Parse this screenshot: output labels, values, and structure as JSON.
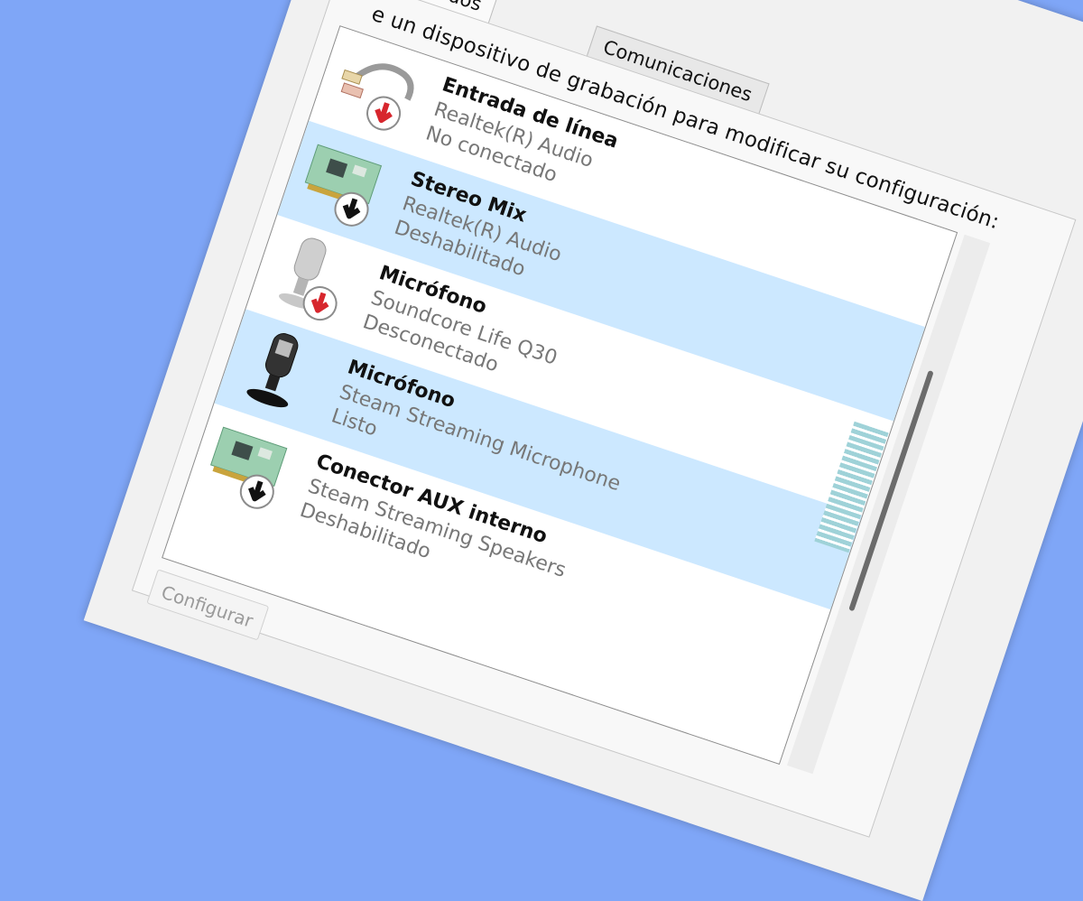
{
  "dialog": {
    "close_symbol": "×",
    "tabs": [
      {
        "label": "nidos"
      },
      {
        "label": "Comunicaciones"
      }
    ],
    "instruction": "e un dispositivo de grabación para modificar su configuración:",
    "configure_button": "Configurar"
  },
  "devices": [
    {
      "name": "Entrada de línea",
      "driver": "Realtek(R) Audio",
      "status": "No conectado",
      "icon": "line-in-cable-icon",
      "badge": "red-down-arrow"
    },
    {
      "name": "Stereo Mix",
      "driver": "Realtek(R) Audio",
      "status": "Deshabilitado",
      "icon": "sound-card-icon",
      "badge": "black-down-arrow"
    },
    {
      "name": "Micrófono",
      "driver": "Soundcore Life Q30",
      "status": "Desconectado",
      "icon": "microphone-gray-icon",
      "badge": "red-down-arrow"
    },
    {
      "name": "Micrófono",
      "driver": "Steam Streaming Microphone",
      "status": "Listo",
      "icon": "microphone-black-icon",
      "badge": "none"
    },
    {
      "name": "Conector AUX interno",
      "driver": "Steam Streaming Speakers",
      "status": "Deshabilitado",
      "icon": "sound-card-icon",
      "badge": "black-down-arrow"
    }
  ],
  "colors": {
    "background": "#7fa6f7",
    "selection": "#cce8ff",
    "badge_red": "#d7262d"
  }
}
